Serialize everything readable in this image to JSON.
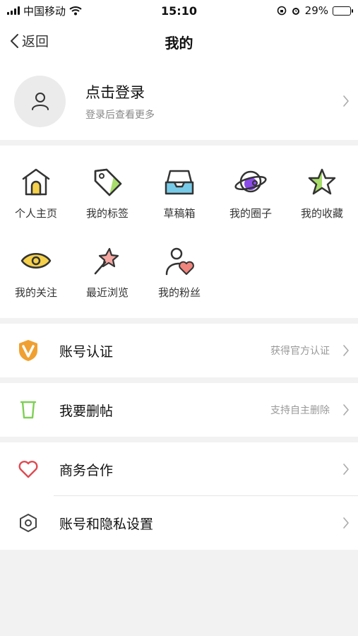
{
  "status_bar": {
    "carrier": "中国移动",
    "time": "15:10",
    "battery": "29%",
    "battery_level": 0.29
  },
  "nav": {
    "back": "返回",
    "title": "我的"
  },
  "profile": {
    "login": "点击登录",
    "subtitle": "登录后查看更多"
  },
  "grid": [
    {
      "label": "个人主页",
      "icon": "home-icon"
    },
    {
      "label": "我的标签",
      "icon": "tag-icon"
    },
    {
      "label": "草稿箱",
      "icon": "drafts-tray-icon"
    },
    {
      "label": "我的圈子",
      "icon": "planet-icon"
    },
    {
      "label": "我的收藏",
      "icon": "star-icon"
    },
    {
      "label": "我的关注",
      "icon": "eye-icon"
    },
    {
      "label": "最近浏览",
      "icon": "magic-wand-icon"
    },
    {
      "label": "我的粉丝",
      "icon": "fans-heart-icon"
    }
  ],
  "rows": [
    {
      "label": "账号认证",
      "hint": "获得官方认证",
      "icon": "verified-v-icon"
    },
    {
      "label": "我要删帖",
      "hint": "支持自主删除",
      "icon": "trash-cup-icon"
    },
    {
      "label": "商务合作",
      "hint": "",
      "icon": "heart-icon"
    },
    {
      "label": "账号和隐私设置",
      "hint": "",
      "icon": "settings-hexagon-icon"
    }
  ],
  "colors": {
    "accent_green": "#a8dd6b",
    "accent_yellow": "#f5d04a",
    "accent_purple": "#8a4be8",
    "accent_blue": "#78cbe8",
    "accent_red": "#e04a52",
    "accent_orange": "#f0a030"
  }
}
